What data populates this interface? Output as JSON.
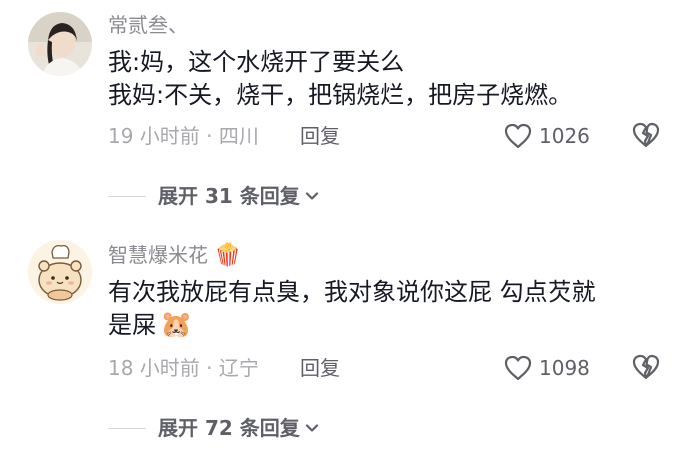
{
  "comments": [
    {
      "username": "常贰叁、",
      "lines": [
        "我:妈，这个水烧开了要关么",
        "我妈:不关，烧干，把锅烧烂，把房子烧燃。"
      ],
      "time_location": "19 小时前 · 四川",
      "reply_label": "回复",
      "like_count": "1026",
      "expand_label": "展开 31 条回复"
    },
    {
      "username": "智慧爆米花",
      "username_emoji": "🍿",
      "lines": [
        "有次我放屁有点臭，我对象说你这屁 勾点芡就",
        "是屎"
      ],
      "trailing_emoji": "🐹",
      "time_location": "18 小时前 · 辽宁",
      "reply_label": "回复",
      "like_count": "1098",
      "expand_label": "展开 72 条回复"
    }
  ],
  "colors": {
    "username": "#8a8b91",
    "body_text": "#161823",
    "meta": "#a8a9ad",
    "action": "#5f6067",
    "divider": "#d7d8da"
  },
  "icons": {
    "like": "heart-outline-icon",
    "dislike": "broken-heart-icon",
    "expand": "chevron-down-icon"
  }
}
